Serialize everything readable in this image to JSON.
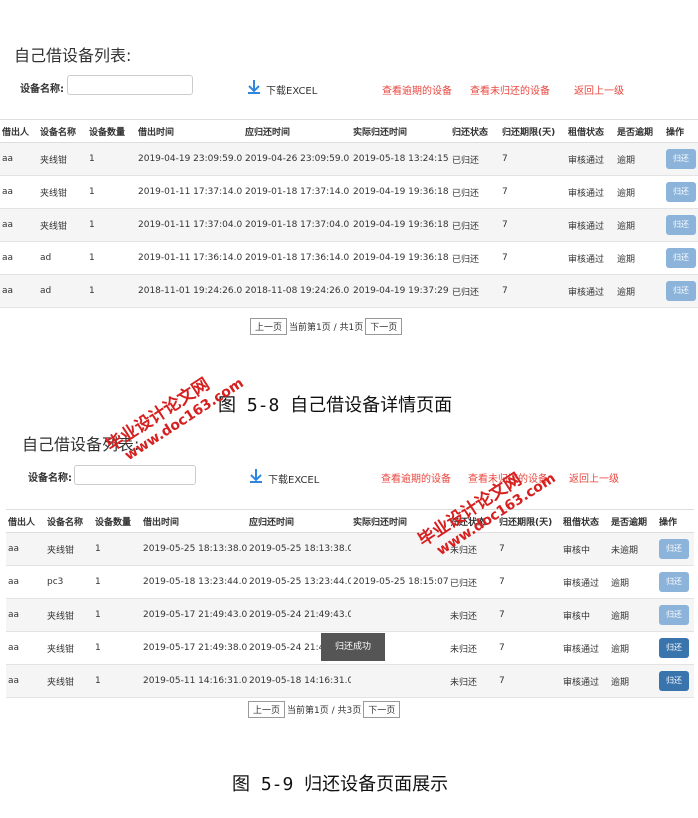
{
  "panel1": {
    "title": "自己借设备列表:",
    "label": "设备名称:",
    "input_value": "",
    "download": "下载EXCEL",
    "links": [
      "查看逾期的设备",
      "查看未归还的设备",
      "返回上一级"
    ],
    "headers": [
      "借出人",
      "设备名称",
      "设备数量",
      "借出时间",
      "应归还时间",
      "实际归还时间",
      "归还状态",
      "归还期限(天)",
      "租借状态",
      "是否逾期",
      "操作"
    ],
    "rows": [
      [
        "aa",
        "夹线钳",
        "1",
        "2019-04-19 23:09:59.0",
        "2019-04-26 23:09:59.0",
        "2019-05-18 13:24:15",
        "已归还",
        "7",
        "审核通过",
        "逾期",
        "归还"
      ],
      [
        "aa",
        "夹线钳",
        "1",
        "2019-01-11 17:37:14.0",
        "2019-01-18 17:37:14.0",
        "2019-04-19 19:36:18",
        "已归还",
        "7",
        "审核通过",
        "逾期",
        "归还"
      ],
      [
        "aa",
        "夹线钳",
        "1",
        "2019-01-11 17:37:04.0",
        "2019-01-18 17:37:04.0",
        "2019-04-19 19:36:18",
        "已归还",
        "7",
        "审核通过",
        "逾期",
        "归还"
      ],
      [
        "aa",
        "ad",
        "1",
        "2019-01-11 17:36:14.0",
        "2019-01-18 17:36:14.0",
        "2019-04-19 19:36:18",
        "已归还",
        "7",
        "审核通过",
        "逾期",
        "归还"
      ],
      [
        "aa",
        "ad",
        "1",
        "2018-11-01 19:24:26.0",
        "2018-11-08 19:24:26.0",
        "2019-04-19 19:37:29",
        "已归还",
        "7",
        "审核通过",
        "逾期",
        "归还"
      ]
    ],
    "pager": {
      "prev": "上一页",
      "info": "当前第1页 / 共1页",
      "next": "下一页"
    },
    "caption": "图 5-8 自己借设备详情页面"
  },
  "panel2": {
    "title": "自己借设备列表:",
    "label": "设备名称:",
    "input_value": "",
    "download": "下载EXCEL",
    "links": [
      "查看逾期的设备",
      "查看未归还的设备",
      "返回上一级"
    ],
    "headers": [
      "借出人",
      "设备名称",
      "设备数量",
      "借出时间",
      "应归还时间",
      "实际归还时间",
      "归还状态",
      "归还期限(天)",
      "租借状态",
      "是否逾期",
      "操作"
    ],
    "rows": [
      [
        "aa",
        "夹线钳",
        "1",
        "2019-05-25 18:13:38.0",
        "2019-05-25 18:13:38.0",
        "",
        "未归还",
        "7",
        "审核中",
        "未逾期",
        "归还"
      ],
      [
        "aa",
        "pc3",
        "1",
        "2019-05-18 13:23:44.0",
        "2019-05-25 13:23:44.0",
        "2019-05-25 18:15:07",
        "已归还",
        "7",
        "审核通过",
        "逾期",
        "归还"
      ],
      [
        "aa",
        "夹线钳",
        "1",
        "2019-05-17 21:49:43.0",
        "2019-05-24 21:49:43.0",
        "",
        "未归还",
        "7",
        "审核中",
        "逾期",
        "归还"
      ],
      [
        "aa",
        "夹线钳",
        "1",
        "2019-05-17 21:49:38.0",
        "2019-05-24 21:49:38.0",
        "",
        "未归还",
        "7",
        "审核通过",
        "逾期",
        "归还"
      ],
      [
        "aa",
        "夹线钳",
        "1",
        "2019-05-11 14:16:31.0",
        "2019-05-18 14:16:31.0",
        "",
        "未归还",
        "7",
        "审核通过",
        "逾期",
        "归还"
      ]
    ],
    "pager": {
      "prev": "上一页",
      "info": "当前第1页 / 共3页",
      "next": "下一页"
    },
    "toast": "归还成功",
    "caption": "图 5-9 归还设备页面展示"
  },
  "watermark": {
    "line1": "毕业设计论文网",
    "line2": "www.doc163.com"
  }
}
